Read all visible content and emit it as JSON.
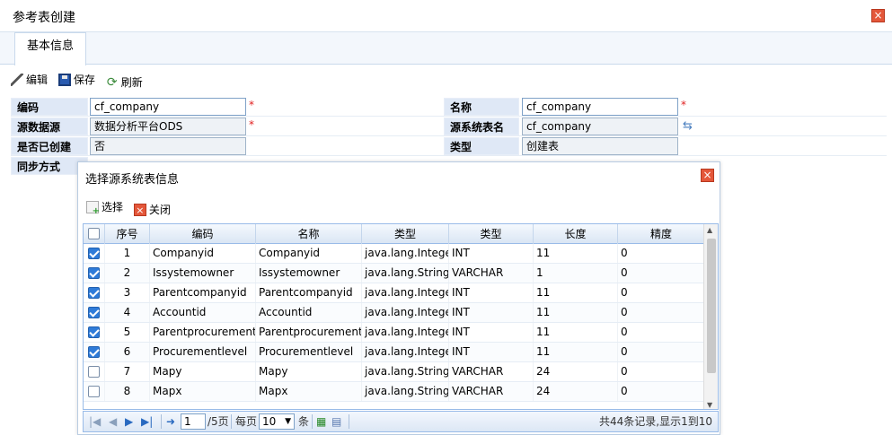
{
  "window": {
    "title": "参考表创建"
  },
  "tabs": [
    {
      "label": "基本信息"
    }
  ],
  "toolbar": {
    "edit": "编辑",
    "save": "保存",
    "refresh": "刷新"
  },
  "form": {
    "left": [
      {
        "label": "编码",
        "value": "cf_company",
        "required": "*"
      },
      {
        "label": "源数据源",
        "value": "数据分析平台ODS",
        "required": "*"
      },
      {
        "label": "是否已创建",
        "value": "否"
      },
      {
        "label": "同步方式",
        "value": ""
      }
    ],
    "right": [
      {
        "label": "名称",
        "value": "cf_company",
        "required": "*"
      },
      {
        "label": "源系统表名",
        "value": "cf_company"
      },
      {
        "label": "类型",
        "value": "创建表"
      }
    ]
  },
  "dialog": {
    "title": "选择源系统表信息",
    "toolbar": {
      "select": "选择",
      "close": "关闭"
    },
    "columns": [
      "序号",
      "编码",
      "名称",
      "类型",
      "类型",
      "长度",
      "精度"
    ],
    "rows": [
      {
        "checked": true,
        "no": "1",
        "code": "Companyid",
        "name": "Companyid",
        "jtype": "java.lang.Integer",
        "dbtype": "INT",
        "len": "11",
        "prec": "0"
      },
      {
        "checked": true,
        "no": "2",
        "code": "Issystemowner",
        "name": "Issystemowner",
        "jtype": "java.lang.String",
        "dbtype": "VARCHAR",
        "len": "1",
        "prec": "0"
      },
      {
        "checked": true,
        "no": "3",
        "code": "Parentcompanyid",
        "name": "Parentcompanyid",
        "jtype": "java.lang.Integer",
        "dbtype": "INT",
        "len": "11",
        "prec": "0"
      },
      {
        "checked": true,
        "no": "4",
        "code": "Accountid",
        "name": "Accountid",
        "jtype": "java.lang.Integer",
        "dbtype": "INT",
        "len": "11",
        "prec": "0"
      },
      {
        "checked": true,
        "no": "5",
        "code": "Parentprocurementid",
        "name": "Parentprocurementid",
        "jtype": "java.lang.Integer",
        "dbtype": "INT",
        "len": "11",
        "prec": "0"
      },
      {
        "checked": true,
        "no": "6",
        "code": "Procurementlevel",
        "name": "Procurementlevel",
        "jtype": "java.lang.Integer",
        "dbtype": "INT",
        "len": "11",
        "prec": "0"
      },
      {
        "checked": false,
        "no": "7",
        "code": "Mapy",
        "name": "Mapy",
        "jtype": "java.lang.String",
        "dbtype": "VARCHAR",
        "len": "24",
        "prec": "0"
      },
      {
        "checked": false,
        "no": "8",
        "code": "Mapx",
        "name": "Mapx",
        "jtype": "java.lang.String",
        "dbtype": "VARCHAR",
        "len": "24",
        "prec": "0"
      }
    ],
    "pager": {
      "page": "1",
      "total_pages": "/5页",
      "per_page_label": "每页",
      "per_page": "10",
      "unit": "条",
      "summary": "共44条记录,显示1到10"
    }
  }
}
